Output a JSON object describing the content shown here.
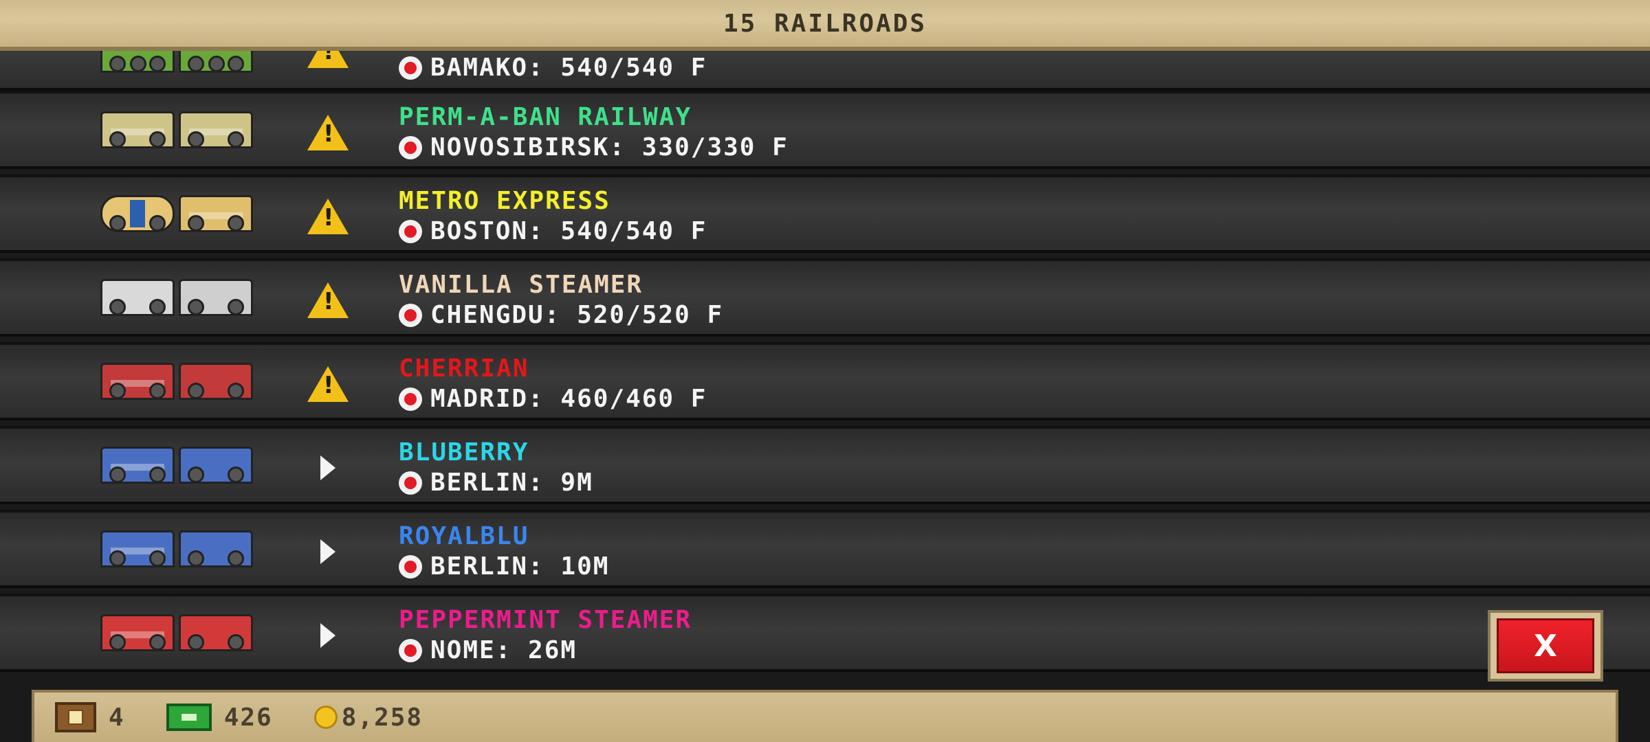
{
  "header": {
    "title": "15 RAILROADS"
  },
  "rows": [
    {
      "name": "",
      "name_color": "#7ed957",
      "destination": "BAMAKO: 540/540 F",
      "status": "warning-icon",
      "colors": [
        "#6aa83a",
        "#6aa83a"
      ]
    },
    {
      "name": "PERM-A-BAN RAILWAY",
      "name_color": "#3fe08a",
      "destination": "NOVOSIBIRSK: 330/330 F",
      "status": "warning-icon",
      "colors": [
        "#cfc487",
        "#cfc487"
      ]
    },
    {
      "name": "METRO EXPRESS",
      "name_color": "#f3ef2b",
      "destination": "BOSTON: 540/540 F",
      "status": "warning-icon",
      "colors": [
        "#e6c675",
        "#e0be6e"
      ]
    },
    {
      "name": "VANILLA STEAMER",
      "name_color": "#f0d6b8",
      "destination": "CHENGDU: 520/520 F",
      "status": "warning-icon",
      "colors": [
        "#d9d9d9",
        "#cfcfcf"
      ]
    },
    {
      "name": "CHERRIAN",
      "name_color": "#e3171b",
      "destination": "MADRID: 460/460 F",
      "status": "warning-icon",
      "colors": [
        "#c23a3a",
        "#c23a3a"
      ]
    },
    {
      "name": "BLUBERRY",
      "name_color": "#2bd6e8",
      "destination": "BERLIN: 9M",
      "status": "play-icon",
      "colors": [
        "#4a6fc2",
        "#4a6fc2"
      ]
    },
    {
      "name": "ROYALBLU",
      "name_color": "#3a86f0",
      "destination": "BERLIN: 10M",
      "status": "play-icon",
      "colors": [
        "#4a6fc2",
        "#4a6fc2"
      ]
    },
    {
      "name": "PEPPERMINT STEAMER",
      "name_color": "#ec1c8c",
      "destination": "NOME: 26M",
      "status": "play-icon",
      "colors": [
        "#d23a3a",
        "#d23a3a"
      ]
    }
  ],
  "close_button": {
    "label": "X"
  },
  "footer": {
    "crates": "4",
    "cash": "426",
    "coins": "8,258"
  }
}
